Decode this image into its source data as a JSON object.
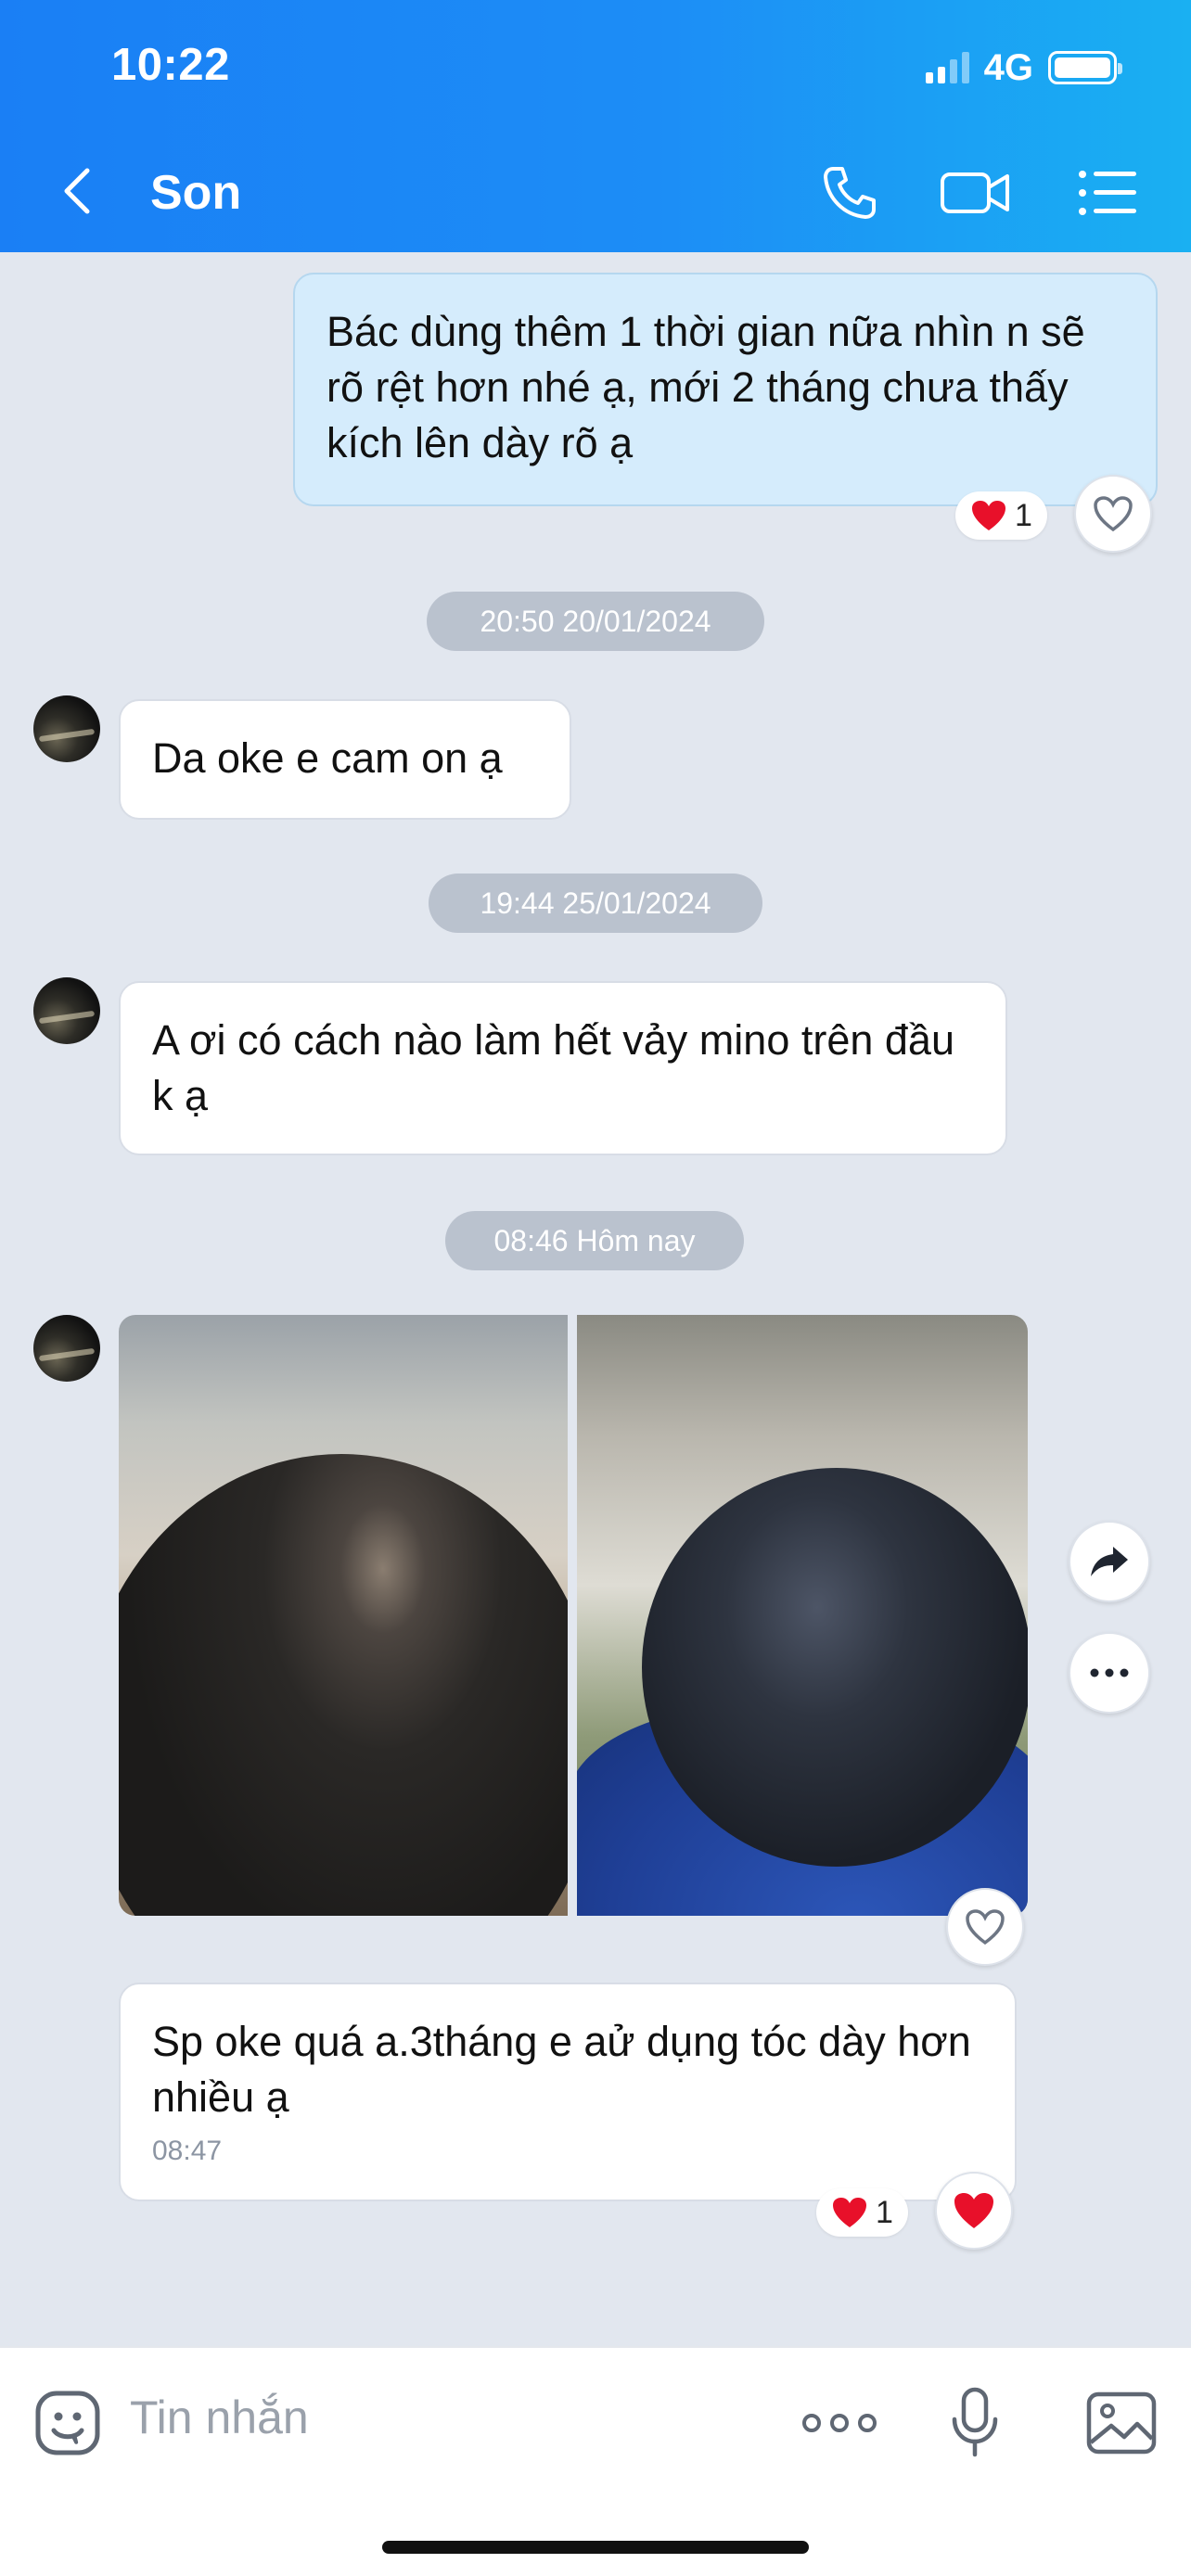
{
  "status_bar": {
    "time": "10:22",
    "network": "4G"
  },
  "header": {
    "contact_name": "Son"
  },
  "messages": [
    {
      "text": "Bác dùng thêm 1 thời gian nữa nhìn n sẽ rõ rệt hơn nhé ạ, mới 2 tháng chưa thấy kích lên dày rõ ạ",
      "reaction_count": "1"
    },
    {
      "date": "20:50 20/01/2024"
    },
    {
      "text": "Da oke e cam on ạ"
    },
    {
      "date": "19:44 25/01/2024"
    },
    {
      "text": "A ơi có cách nào làm hết vảy mino trên đầu k ạ"
    },
    {
      "date": "08:46 Hôm nay"
    },
    {
      "text": "Sp oke quá a.3tháng e aử dụng tóc dày hơn nhiều ạ",
      "time": "08:47",
      "reaction_count": "1"
    }
  ],
  "composer": {
    "placeholder": "Tin nhắn"
  },
  "colors": {
    "header_start": "#1a7ff5",
    "header_end": "#1ab0f2",
    "out_bubble": "#d5ecfc",
    "heart": "#e8102a"
  },
  "icons": [
    "back-arrow",
    "phone",
    "video",
    "menu-list",
    "heart",
    "heart-outline",
    "share",
    "more",
    "sticker",
    "dots",
    "microphone",
    "image"
  ]
}
